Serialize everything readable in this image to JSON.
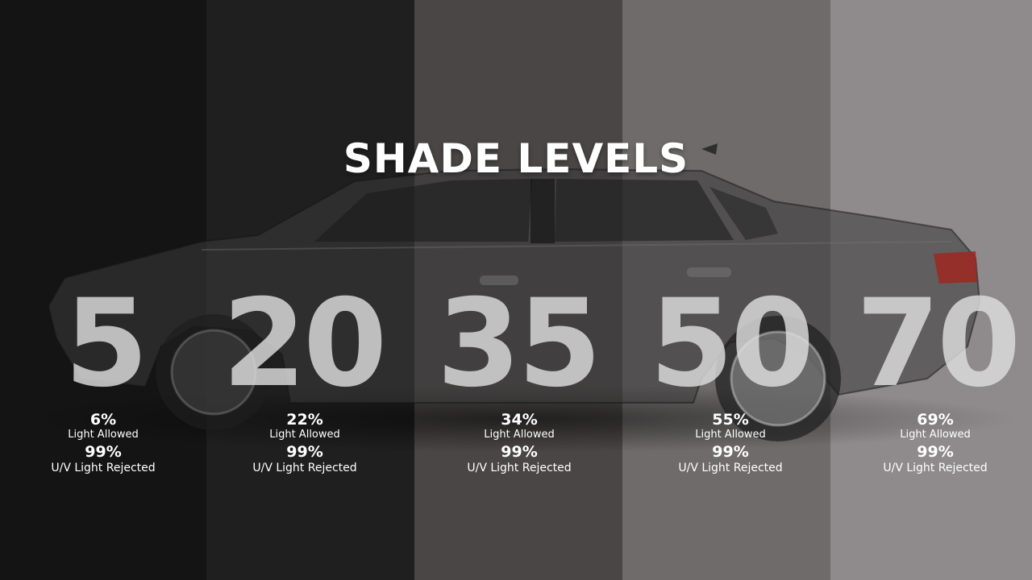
{
  "title": "SHADE LEVELS",
  "colors": {
    "band_0": "#141414",
    "band_1": "#1f1f1f",
    "band_2": "#4a4645",
    "band_3": "#6f6b6b",
    "band_4": "#8f8b8c",
    "car_body": "#3a3a3a",
    "taillight": "#9a2a25",
    "text": "#ffffff"
  },
  "levels": [
    {
      "number": "5",
      "light_pct": "6%",
      "light_label": "Light Allowed",
      "uv_pct": "99%",
      "uv_label": "U/V Light Rejected"
    },
    {
      "number": "20",
      "light_pct": "22%",
      "light_label": "Light Allowed",
      "uv_pct": "99%",
      "uv_label": "U/V Light Rejected"
    },
    {
      "number": "35",
      "light_pct": "34%",
      "light_label": "Light Allowed",
      "uv_pct": "99%",
      "uv_label": "U/V Light Rejected"
    },
    {
      "number": "50",
      "light_pct": "55%",
      "light_label": "Light Allowed",
      "uv_pct": "99%",
      "uv_label": "U/V Light Rejected"
    },
    {
      "number": "70",
      "light_pct": "69%",
      "light_label": "Light Allowed",
      "uv_pct": "99%",
      "uv_label": "U/V Light Rejected"
    }
  ]
}
